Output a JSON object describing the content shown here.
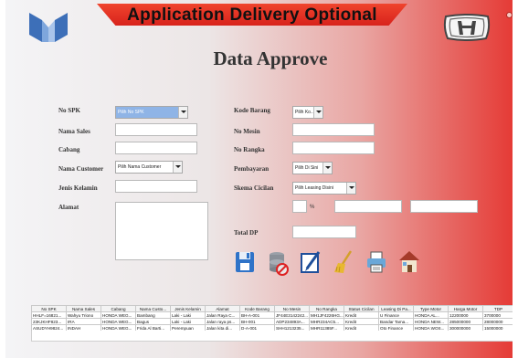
{
  "header": {
    "title": "Application Delivery Optional"
  },
  "page": {
    "title": "Data Approve"
  },
  "left_form": {
    "no_spk": {
      "label": "No SPK",
      "value": "Pilih No SPK"
    },
    "nama_sales": {
      "label": "Nama Sales",
      "value": ""
    },
    "cabang": {
      "label": "Cabang",
      "value": ""
    },
    "nama_customer": {
      "label": "Nama Customer",
      "value": "Pilih Nama Customer"
    },
    "jenis_kelamin": {
      "label": "Jenis Kelamin",
      "value": ""
    },
    "alamat": {
      "label": "Alamat",
      "value": ""
    }
  },
  "right_form": {
    "kode_barang": {
      "label": "Kode Barang",
      "value": "Pilih Ko..."
    },
    "no_mesin": {
      "label": "No Mesin",
      "value": ""
    },
    "no_rangka": {
      "label": "No Rangka",
      "value": ""
    },
    "pembayaran": {
      "label": "Pembayaran",
      "value": "Pilih Di Sini"
    },
    "skema_cicilan": {
      "label": "Skema Cicilan",
      "value": "Pilih Leasing Disini"
    },
    "percent_sign": "%",
    "total_dp": {
      "label": "Total DP",
      "value": ""
    }
  },
  "toolbar": {
    "save": "save-icon",
    "delete": "delete-icon",
    "edit": "edit-icon",
    "clear": "broom-icon",
    "print": "printer-icon",
    "home": "home-icon"
  },
  "table": {
    "columns": [
      "No SPK",
      "Nama Sales",
      "Cabang",
      "Nama Custo...",
      "Jenis Kelamin",
      "Alamat",
      "Kode Barang",
      "No Mesin",
      "No Rangka",
      "Status Cicilan",
      "Leasing Di Pa...",
      "Type Motor",
      "Harga Motor",
      "TDP"
    ],
    "rows": [
      [
        "HHLF=16821...",
        "Wahyu Triono",
        "HONDA WEG...",
        "Bambang",
        "Laki - Laki",
        "Jalan Raya C...",
        "BH-A-001",
        "JF44E3142242...",
        "MH1JF4226HG...",
        "Kredit",
        "U Finance",
        "HONDA AL...",
        "12200000",
        "3700000"
      ],
      [
        "23KJKHF823...",
        "IRA",
        "HONDA WEG...",
        "Bagus",
        "Laki - Laki",
        "Jalan raya ps...",
        "BH-001",
        "ADP234893A...",
        "MHR234AC5...",
        "Kredit",
        "Bandar Tama...",
        "HONDA NEW...",
        "285000000",
        "28000000"
      ],
      [
        "ASUDYH9824...",
        "INDAH",
        "HONDA WEG...",
        "Frida Al Barti...",
        "Perempuan",
        "Jalan kita di...",
        "D-A-001",
        "SHH1213235...",
        "MHR11385F...",
        "Kredit",
        "Oto Finance",
        "HONDA WOS...",
        "300000000",
        "15000000"
      ],
      [
        "AHRJ3624JS...",
        "INTAN",
        "HONDA WEG...",
        "Bella",
        "Perempuan",
        "Jalan Olepu...",
        "D-A-001",
        "SMDA90709...",
        "MHR1 28128...",
        "Tunai",
        "Lunas",
        "HONDA BRI...",
        "300000000",
        ""
      ]
    ]
  },
  "colors": {
    "banner_red": "#e0301f",
    "accent_right": "#e53b36",
    "active_combo": "#8fb4e6"
  }
}
